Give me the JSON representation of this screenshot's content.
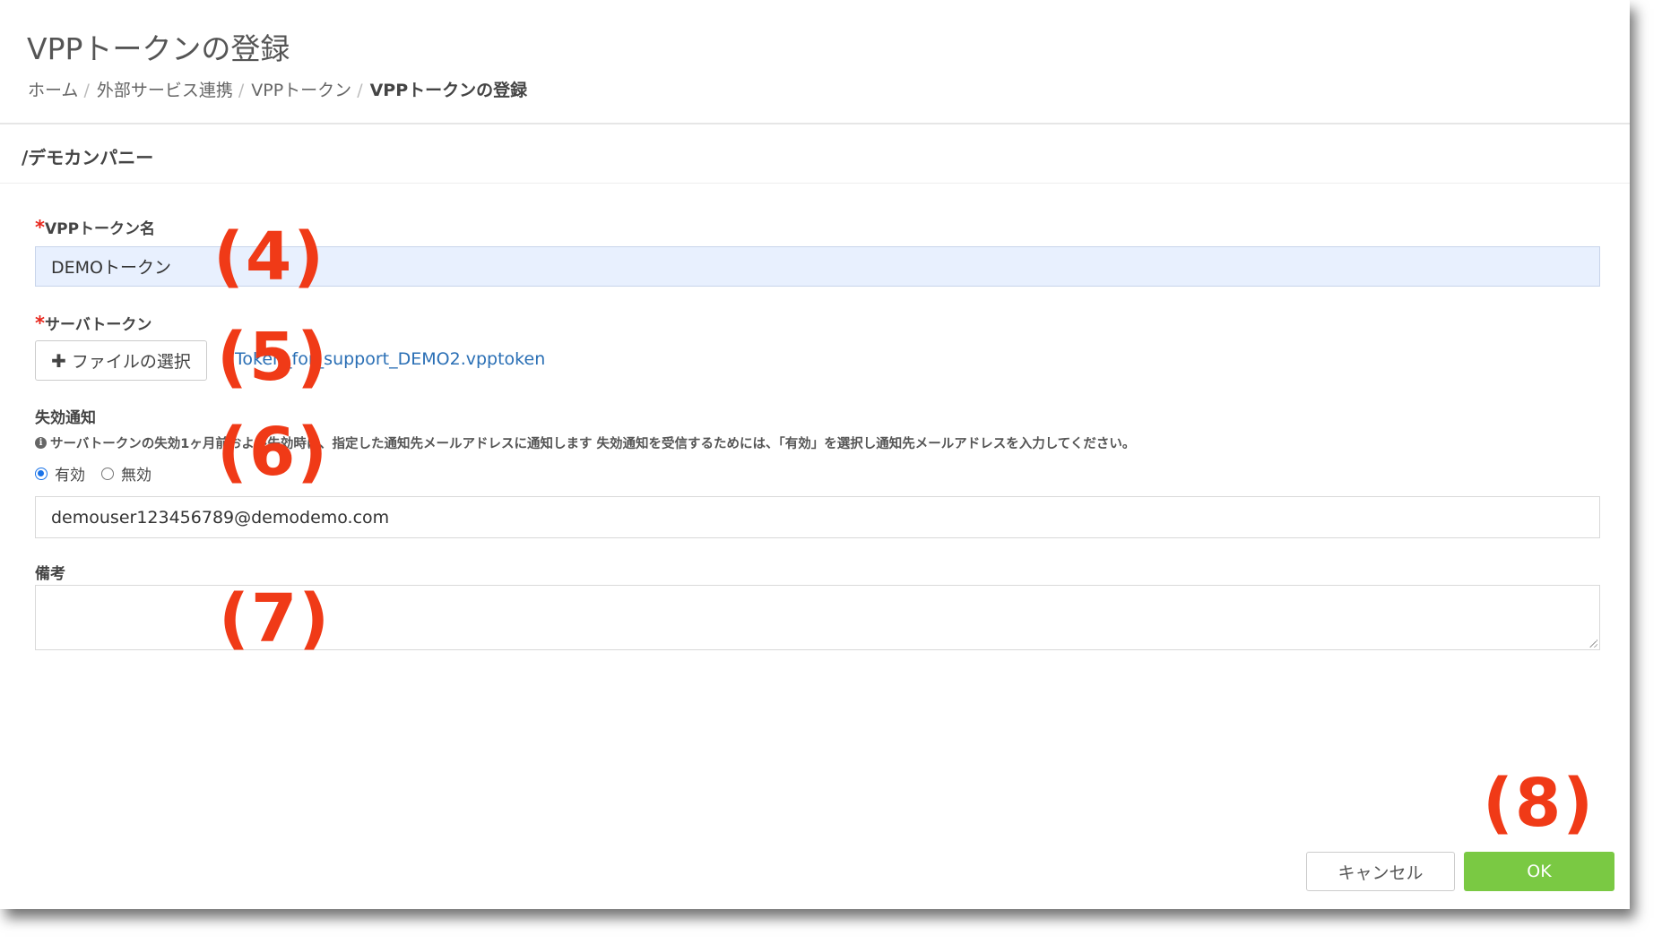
{
  "header": {
    "title": "VPPトークンの登録",
    "breadcrumb": [
      "ホーム",
      "外部サービス連携",
      "VPPトークン",
      "VPPトークンの登録"
    ],
    "breadcrumb_separator": "/"
  },
  "org_path": "/デモカンパニー",
  "form": {
    "token_name": {
      "label": "VPPトークン名",
      "required_mark": "*",
      "value": "DEMOトークン"
    },
    "server_token": {
      "label": "サーバトークン",
      "required_mark": "*",
      "button_label": "ファイルの選択",
      "button_icon": "plus-icon",
      "file_name": "Token_for_support_DEMO2.vpptoken"
    },
    "expiry_notice": {
      "label": "失効通知",
      "help_text": "サーバトークンの失効1ヶ月前および失効時に、指定した通知先メールアドレスに通知します 失効通知を受信するためには、「有効」を選択し通知先メールアドレスを入力してください。",
      "options": [
        {
          "label": "有効",
          "checked": true
        },
        {
          "label": "無効",
          "checked": false
        }
      ],
      "email": "demouser123456789@demodemo.com"
    },
    "remarks": {
      "label": "備考",
      "value": ""
    }
  },
  "footer": {
    "cancel_label": "キャンセル",
    "ok_label": "OK"
  },
  "annotations": [
    "(4)",
    "(5)",
    "(6)",
    "(7)",
    "(8)"
  ],
  "colors": {
    "ok_button": "#7ac943",
    "required": "#e8281e",
    "link": "#2a6fb5",
    "annotation": "#f03a17",
    "filled_input": "#e8f0fe"
  }
}
